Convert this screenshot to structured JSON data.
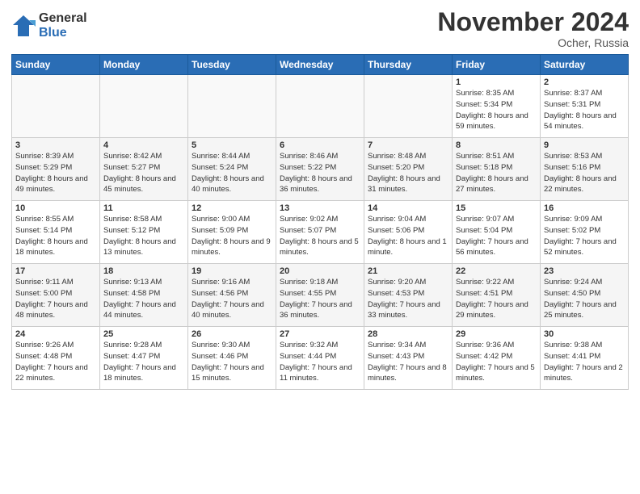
{
  "logo": {
    "general": "General",
    "blue": "Blue"
  },
  "title": "November 2024",
  "location": "Ocher, Russia",
  "days_header": [
    "Sunday",
    "Monday",
    "Tuesday",
    "Wednesday",
    "Thursday",
    "Friday",
    "Saturday"
  ],
  "weeks": [
    [
      {
        "num": "",
        "info": ""
      },
      {
        "num": "",
        "info": ""
      },
      {
        "num": "",
        "info": ""
      },
      {
        "num": "",
        "info": ""
      },
      {
        "num": "",
        "info": ""
      },
      {
        "num": "1",
        "info": "Sunrise: 8:35 AM\nSunset: 5:34 PM\nDaylight: 8 hours and 59 minutes."
      },
      {
        "num": "2",
        "info": "Sunrise: 8:37 AM\nSunset: 5:31 PM\nDaylight: 8 hours and 54 minutes."
      }
    ],
    [
      {
        "num": "3",
        "info": "Sunrise: 8:39 AM\nSunset: 5:29 PM\nDaylight: 8 hours and 49 minutes."
      },
      {
        "num": "4",
        "info": "Sunrise: 8:42 AM\nSunset: 5:27 PM\nDaylight: 8 hours and 45 minutes."
      },
      {
        "num": "5",
        "info": "Sunrise: 8:44 AM\nSunset: 5:24 PM\nDaylight: 8 hours and 40 minutes."
      },
      {
        "num": "6",
        "info": "Sunrise: 8:46 AM\nSunset: 5:22 PM\nDaylight: 8 hours and 36 minutes."
      },
      {
        "num": "7",
        "info": "Sunrise: 8:48 AM\nSunset: 5:20 PM\nDaylight: 8 hours and 31 minutes."
      },
      {
        "num": "8",
        "info": "Sunrise: 8:51 AM\nSunset: 5:18 PM\nDaylight: 8 hours and 27 minutes."
      },
      {
        "num": "9",
        "info": "Sunrise: 8:53 AM\nSunset: 5:16 PM\nDaylight: 8 hours and 22 minutes."
      }
    ],
    [
      {
        "num": "10",
        "info": "Sunrise: 8:55 AM\nSunset: 5:14 PM\nDaylight: 8 hours and 18 minutes."
      },
      {
        "num": "11",
        "info": "Sunrise: 8:58 AM\nSunset: 5:12 PM\nDaylight: 8 hours and 13 minutes."
      },
      {
        "num": "12",
        "info": "Sunrise: 9:00 AM\nSunset: 5:09 PM\nDaylight: 8 hours and 9 minutes."
      },
      {
        "num": "13",
        "info": "Sunrise: 9:02 AM\nSunset: 5:07 PM\nDaylight: 8 hours and 5 minutes."
      },
      {
        "num": "14",
        "info": "Sunrise: 9:04 AM\nSunset: 5:06 PM\nDaylight: 8 hours and 1 minute."
      },
      {
        "num": "15",
        "info": "Sunrise: 9:07 AM\nSunset: 5:04 PM\nDaylight: 7 hours and 56 minutes."
      },
      {
        "num": "16",
        "info": "Sunrise: 9:09 AM\nSunset: 5:02 PM\nDaylight: 7 hours and 52 minutes."
      }
    ],
    [
      {
        "num": "17",
        "info": "Sunrise: 9:11 AM\nSunset: 5:00 PM\nDaylight: 7 hours and 48 minutes."
      },
      {
        "num": "18",
        "info": "Sunrise: 9:13 AM\nSunset: 4:58 PM\nDaylight: 7 hours and 44 minutes."
      },
      {
        "num": "19",
        "info": "Sunrise: 9:16 AM\nSunset: 4:56 PM\nDaylight: 7 hours and 40 minutes."
      },
      {
        "num": "20",
        "info": "Sunrise: 9:18 AM\nSunset: 4:55 PM\nDaylight: 7 hours and 36 minutes."
      },
      {
        "num": "21",
        "info": "Sunrise: 9:20 AM\nSunset: 4:53 PM\nDaylight: 7 hours and 33 minutes."
      },
      {
        "num": "22",
        "info": "Sunrise: 9:22 AM\nSunset: 4:51 PM\nDaylight: 7 hours and 29 minutes."
      },
      {
        "num": "23",
        "info": "Sunrise: 9:24 AM\nSunset: 4:50 PM\nDaylight: 7 hours and 25 minutes."
      }
    ],
    [
      {
        "num": "24",
        "info": "Sunrise: 9:26 AM\nSunset: 4:48 PM\nDaylight: 7 hours and 22 minutes."
      },
      {
        "num": "25",
        "info": "Sunrise: 9:28 AM\nSunset: 4:47 PM\nDaylight: 7 hours and 18 minutes."
      },
      {
        "num": "26",
        "info": "Sunrise: 9:30 AM\nSunset: 4:46 PM\nDaylight: 7 hours and 15 minutes."
      },
      {
        "num": "27",
        "info": "Sunrise: 9:32 AM\nSunset: 4:44 PM\nDaylight: 7 hours and 11 minutes."
      },
      {
        "num": "28",
        "info": "Sunrise: 9:34 AM\nSunset: 4:43 PM\nDaylight: 7 hours and 8 minutes."
      },
      {
        "num": "29",
        "info": "Sunrise: 9:36 AM\nSunset: 4:42 PM\nDaylight: 7 hours and 5 minutes."
      },
      {
        "num": "30",
        "info": "Sunrise: 9:38 AM\nSunset: 4:41 PM\nDaylight: 7 hours and 2 minutes."
      }
    ]
  ]
}
